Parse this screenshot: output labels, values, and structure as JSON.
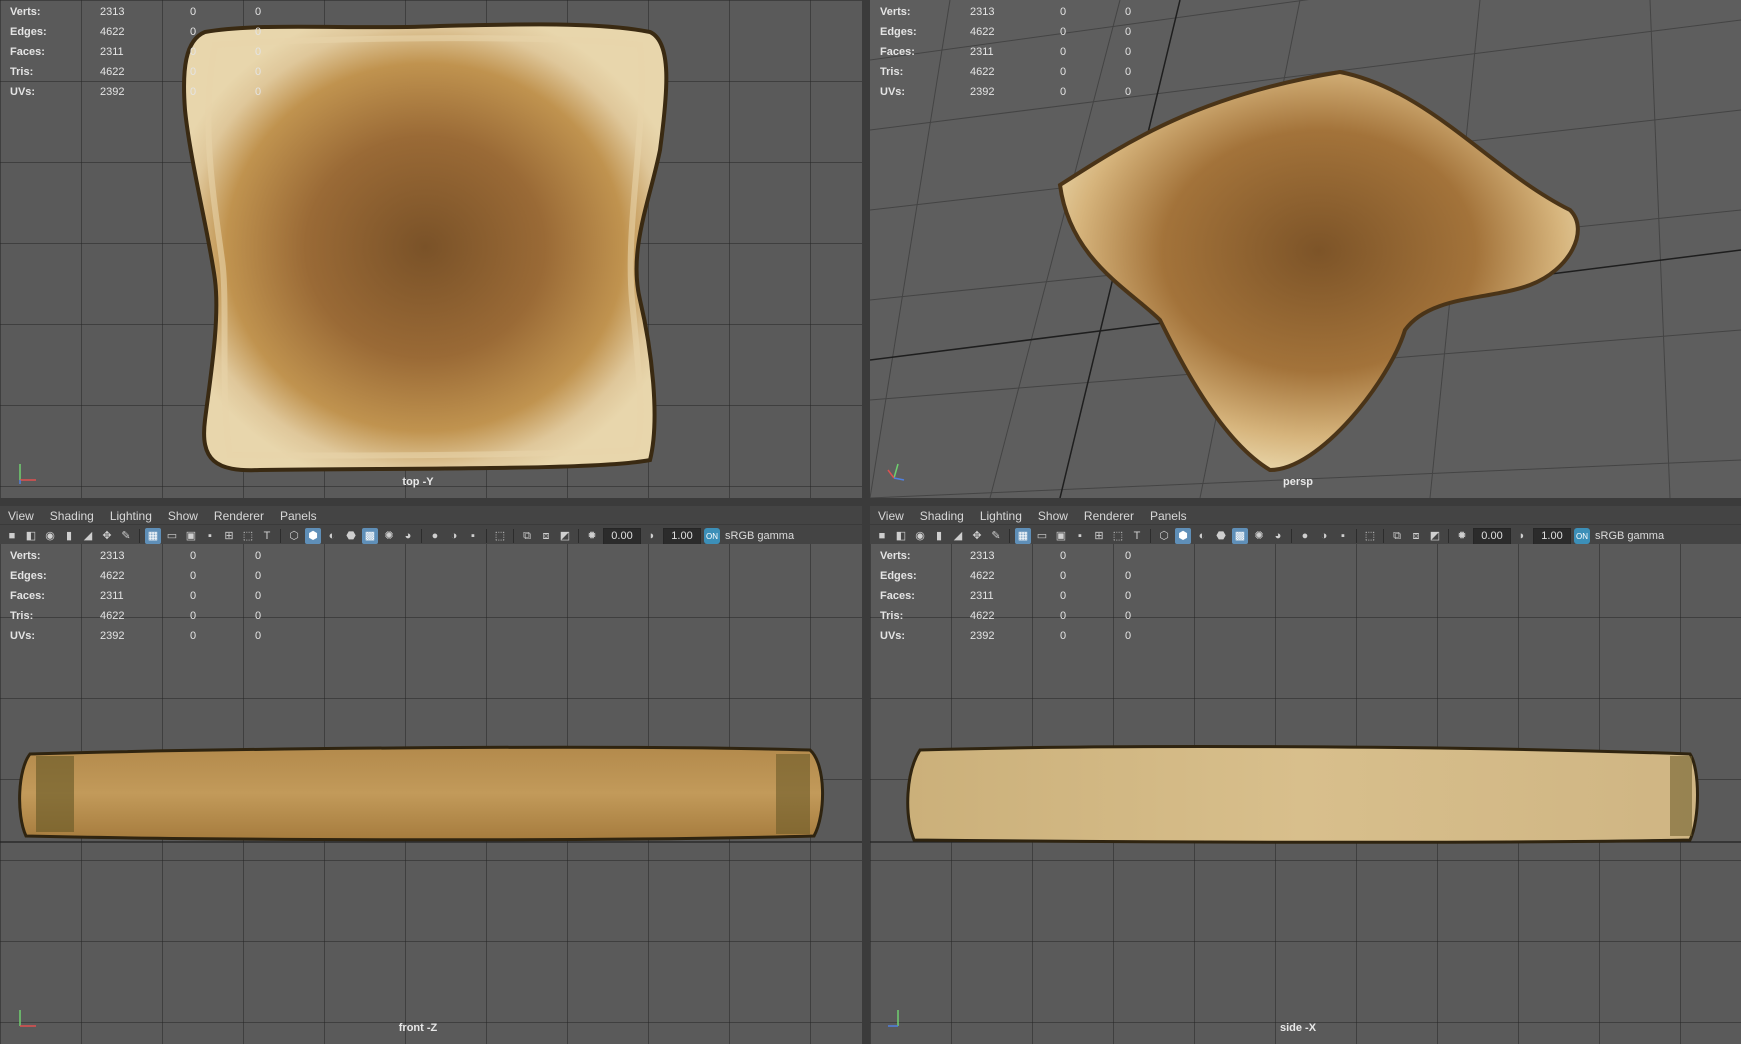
{
  "stats": {
    "rows": [
      {
        "label": "Verts:",
        "v1": "2313",
        "v2": "0",
        "v3": "0"
      },
      {
        "label": "Edges:",
        "v1": "4622",
        "v2": "0",
        "v3": "0"
      },
      {
        "label": "Faces:",
        "v1": "2311",
        "v2": "0",
        "v3": "0"
      },
      {
        "label": "Tris:",
        "v1": "4622",
        "v2": "0",
        "v3": "0"
      },
      {
        "label": "UVs:",
        "v1": "2392",
        "v2": "0",
        "v3": "0"
      }
    ]
  },
  "viewports": {
    "top": {
      "camera": "top -Y"
    },
    "persp": {
      "camera": "persp"
    },
    "front": {
      "camera": "front -Z"
    },
    "side": {
      "camera": "side -X"
    }
  },
  "menu": {
    "view": "View",
    "shading": "Shading",
    "lighting": "Lighting",
    "show": "Show",
    "renderer": "Renderer",
    "panels": "Panels"
  },
  "toolbar": {
    "exposure": "0.00",
    "gamma": "1.00",
    "color_space": "sRGB gamma"
  },
  "colors": {
    "viewport_bg": "#5a5a5a",
    "accent": "#5f8fb8",
    "toast_crust": "#c9a878",
    "toast_center": "#8a6030"
  }
}
